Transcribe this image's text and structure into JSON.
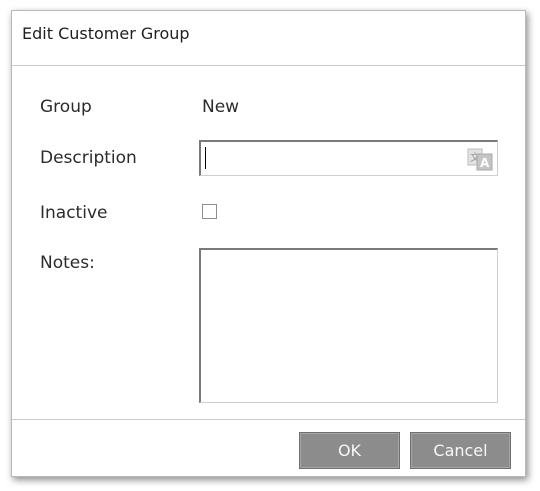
{
  "window": {
    "title": "Edit Customer Group"
  },
  "form": {
    "group_label": "Group",
    "group_value": "New",
    "description_label": "Description",
    "description_value": "",
    "inactive_label": "Inactive",
    "inactive_checked": false,
    "notes_label": "Notes:",
    "notes_value": ""
  },
  "footer": {
    "ok_label": "OK",
    "cancel_label": "Cancel"
  },
  "icons": {
    "description_field_icon": "translate-icon"
  },
  "colors": {
    "button_bg": "#8c8c8c",
    "button_text": "#f7f7f7",
    "border": "#c9c9c9"
  }
}
